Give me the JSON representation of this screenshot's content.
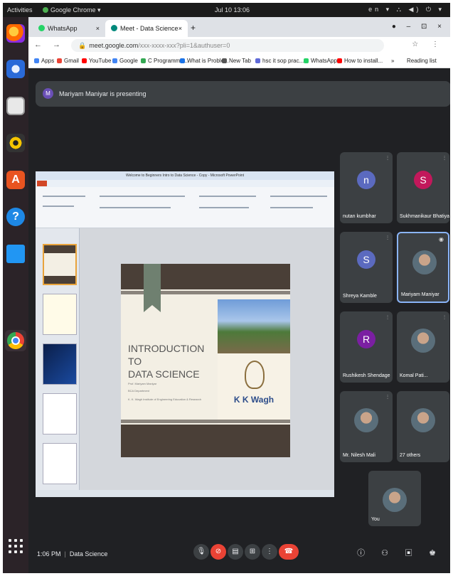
{
  "topbar": {
    "activities": "Activities",
    "app_name": "Google Chrome ▾",
    "clock": "Jul 10 13:06",
    "tray": "en ▾  ⛬ ◀) ⏻ ▾"
  },
  "dock": {
    "items": [
      "firefox-icon",
      "thunderbird-icon",
      "files-icon",
      "rhythmbox-icon",
      "app-center-icon",
      "help-icon",
      "writer-icon",
      "chrome-icon"
    ]
  },
  "browser": {
    "tabs": [
      {
        "label": "WhatsApp",
        "close": "×",
        "color": "#25d366"
      },
      {
        "label": "Meet - Data Science",
        "close": "×",
        "color": "#00897b"
      }
    ],
    "new_tab": "+",
    "window_controls": "● ‒ ⊡ ×",
    "nav": "← → C",
    "url_domain": "meet.google.com",
    "url_path": "/xxx-xxxx-xxx?pli=1&authuser=0",
    "toolbar_right": "☆ ⋮",
    "bookmarks": [
      {
        "label": "Apps",
        "color": "#4285f4"
      },
      {
        "label": "Gmail",
        "color": "#ea4335"
      },
      {
        "label": "YouTube",
        "color": "#ff0000"
      },
      {
        "label": "Google",
        "color": "#4285f4"
      },
      {
        "label": "C Programmin...",
        "color": "#34a853"
      },
      {
        "label": "What is Proble...",
        "color": "#1a73e8"
      },
      {
        "label": "New Tab",
        "color": "#555555"
      },
      {
        "label": "hsc it sop prac...",
        "color": "#5f6ad8"
      },
      {
        "label": "WhatsApp",
        "color": "#25d366"
      },
      {
        "label": "How to install...",
        "color": "#ff0000"
      }
    ],
    "bookmarks_overflow": "»",
    "reading_list": "Reading list"
  },
  "meet": {
    "presenter_initial": "M",
    "presenting_text": "Mariyam Maniyar is presenting",
    "slide": {
      "title_line1": "INTRODUCTION TO",
      "title_line2": "DATA SCIENCE",
      "presenter_line": "Prof. Mariyam Maniyar",
      "dept_line": "BCA Department",
      "institute_line": "K. K. Wagh Institute of Engineering Education & Research",
      "logo_text": "K K Wagh"
    },
    "ppt_title": "Welcome to Beginners Intro to Data Science - Copy - Microsoft PowerPoint",
    "participants": [
      {
        "initial": "n",
        "name": "nutan kumbhar",
        "color": "#5b6abf",
        "photo": false,
        "mic": "⫶"
      },
      {
        "initial": "S",
        "name": "Sukhmanikaur Bhatiya",
        "color": "#c2185b",
        "photo": false,
        "mic": "⫶"
      },
      {
        "initial": "S",
        "name": "Shreya Kamble",
        "color": "#5b6abf",
        "photo": false,
        "mic": "⫶"
      },
      {
        "initial": "",
        "name": "Mariyam Maniyar",
        "color": "#3c4043",
        "photo": true,
        "mic": "◉"
      },
      {
        "initial": "R",
        "name": "Rushikesh Shendage",
        "color": "#7b1fa2",
        "photo": false,
        "mic": "⫶"
      },
      {
        "initial": "",
        "name": "Komal Pati...",
        "color": "#3c4043",
        "photo": true,
        "mic": "⫶"
      },
      {
        "initial": "",
        "name": "Mr. Nilesh Mali",
        "color": "#3c4043",
        "photo": true,
        "mic": "⫶"
      },
      {
        "initial": "",
        "name": "27 others",
        "color": "#3c4043",
        "photo": true,
        "mic": ""
      },
      {
        "initial": "",
        "name": "You",
        "color": "#3c4043",
        "photo": true,
        "mic": ""
      }
    ],
    "bottom": {
      "time": "1:06 PM",
      "separator": "|",
      "meeting_name": "Data Science",
      "controls": [
        {
          "name": "mic-button",
          "glyph": "🎙",
          "red": false
        },
        {
          "name": "camera-off-button",
          "glyph": "⊘",
          "red": true
        },
        {
          "name": "captions-button",
          "glyph": "▤",
          "red": false
        },
        {
          "name": "present-button",
          "glyph": "⊞",
          "red": false
        },
        {
          "name": "more-options-button",
          "glyph": "⋮",
          "red": false
        },
        {
          "name": "leave-call-button",
          "glyph": "☎",
          "red": true
        }
      ],
      "right_icons": "ⓘ ⚇ ▣ ♚"
    }
  }
}
